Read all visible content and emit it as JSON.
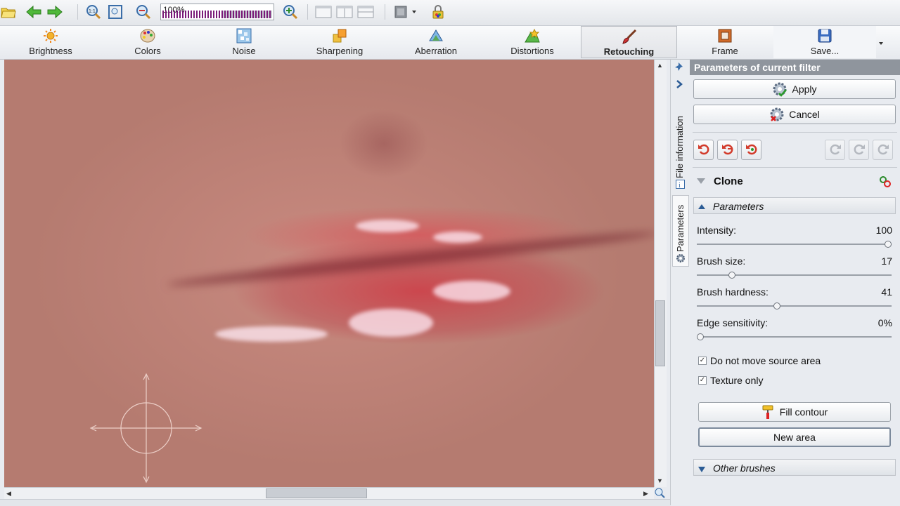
{
  "toolbar": {
    "zoom_value": "100%",
    "zoom_level": 0.55
  },
  "tabs": [
    {
      "label": "Brightness",
      "icon": "sun-icon"
    },
    {
      "label": "Colors",
      "icon": "palette-icon"
    },
    {
      "label": "Noise",
      "icon": "noise-icon"
    },
    {
      "label": "Sharpening",
      "icon": "sharpening-icon"
    },
    {
      "label": "Aberration",
      "icon": "aberration-icon"
    },
    {
      "label": "Distortions",
      "icon": "distortions-icon"
    },
    {
      "label": "Retouching",
      "icon": "brush-icon",
      "active": true
    },
    {
      "label": "Frame",
      "icon": "frame-icon"
    },
    {
      "label": "Save...",
      "icon": "floppy-disk-icon"
    }
  ],
  "sidetabs": {
    "file_information": "File information",
    "parameters": "Parameters"
  },
  "panel": {
    "header": "Parameters of current filter",
    "apply": "Apply",
    "cancel": "Cancel",
    "tool_name": "Clone",
    "parameters_section": "Parameters",
    "params": [
      {
        "label": "Intensity:",
        "value": "100",
        "level": 1.0
      },
      {
        "label": "Brush size:",
        "value": "17",
        "level": 0.17
      },
      {
        "label": "Brush hardness:",
        "value": "41",
        "level": 0.41
      },
      {
        "label": "Edge sensitivity:",
        "value": "0%",
        "level": 0.0
      }
    ],
    "checkboxes": [
      {
        "label": "Do not move source area",
        "checked": true
      },
      {
        "label": "Texture only",
        "checked": true
      }
    ],
    "fill_contour": "Fill contour",
    "new_area": "New area",
    "other_brushes": "Other brushes"
  },
  "colors": {
    "panel_header_bg": "#8f959d",
    "zoom_fill": "#7a1a78"
  }
}
